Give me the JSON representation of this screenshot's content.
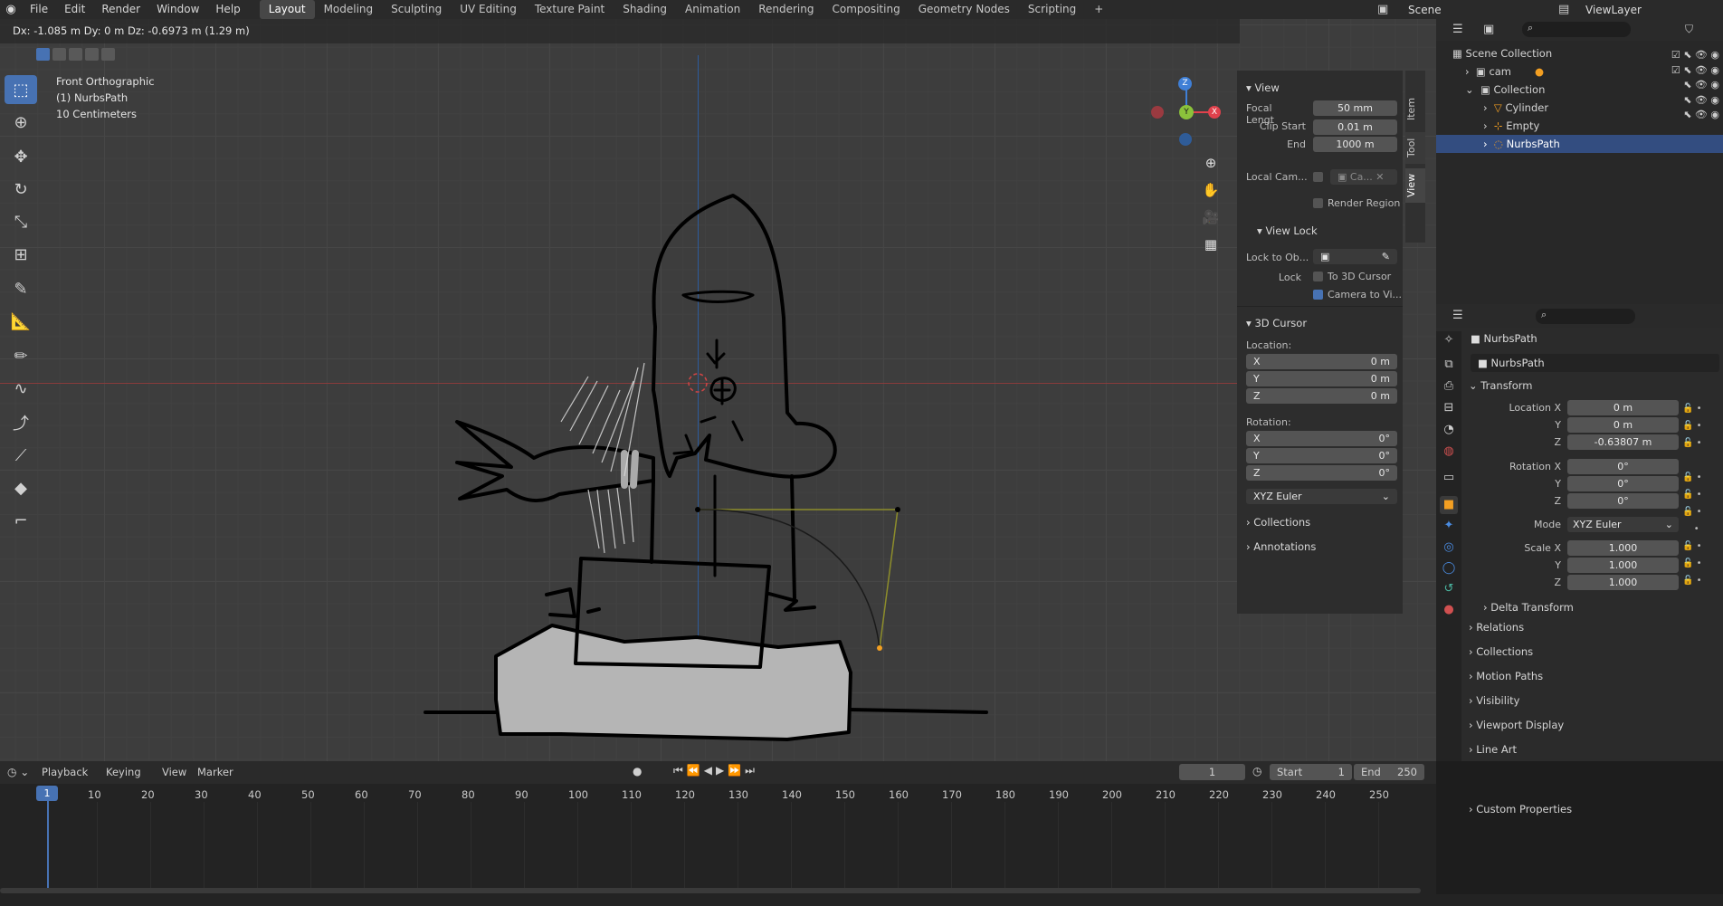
{
  "menu": {
    "blender_icon": "blender-logo-icon",
    "items": [
      "File",
      "Edit",
      "Render",
      "Window",
      "Help"
    ]
  },
  "workspaces": [
    "Layout",
    "Modeling",
    "Sculpting",
    "UV Editing",
    "Texture Paint",
    "Shading",
    "Animation",
    "Rendering",
    "Compositing",
    "Geometry Nodes",
    "Scripting"
  ],
  "scene": {
    "label": "Scene",
    "view_layer": "ViewLayer"
  },
  "viewport": {
    "header_text": "Dx: -1.085 m   Dy: 0 m   Dz: -0.6973 m (1.29 m)",
    "view_name": "Front Orthographic",
    "object_name": "(1) NurbsPath",
    "scale_text": "10 Centimeters",
    "gizmo": {
      "z": "Z",
      "y": "Y",
      "x": "X"
    }
  },
  "npanel": {
    "view_title": "View",
    "focal_label": "Focal Lengt",
    "focal_value": "50 mm",
    "clip_start_label": "Clip Start",
    "clip_start_value": "0.01 m",
    "clip_end_label": "End",
    "clip_end_value": "1000 m",
    "local_cam_label": "Local Cam...",
    "local_cam_value": "Ca...",
    "render_region": "Render Region",
    "view_lock_title": "View Lock",
    "lock_obj_label": "Lock to Ob...",
    "lock_label": "Lock",
    "to_cursor": "To 3D Cursor",
    "cam_to_view": "Camera to Vi...",
    "cursor_title": "3D Cursor",
    "location_label": "Location:",
    "loc": [
      {
        "axis": "X",
        "value": "0 m"
      },
      {
        "axis": "Y",
        "value": "0 m"
      },
      {
        "axis": "Z",
        "value": "0 m"
      }
    ],
    "rotation_label": "Rotation:",
    "rot": [
      {
        "axis": "X",
        "value": "0°"
      },
      {
        "axis": "Y",
        "value": "0°"
      },
      {
        "axis": "Z",
        "value": "0°"
      }
    ],
    "rot_mode": "XYZ Euler",
    "collections": "Collections",
    "annotations": "Annotations",
    "tabs": [
      "Item",
      "Tool",
      "View"
    ]
  },
  "outliner": {
    "root": "Scene Collection",
    "rows": [
      {
        "name": "cam",
        "indent": 1
      },
      {
        "name": "Collection",
        "indent": 1
      },
      {
        "name": "Cylinder",
        "indent": 2
      },
      {
        "name": "Empty",
        "indent": 2
      },
      {
        "name": "NurbsPath",
        "indent": 2
      }
    ]
  },
  "properties": {
    "object_name": "NurbsPath",
    "data_name": "NurbsPath",
    "transform_title": "Transform",
    "location": [
      {
        "label": "Location X",
        "value": "0 m"
      },
      {
        "label": "Y",
        "value": "0 m"
      },
      {
        "label": "Z",
        "value": "-0.63807 m"
      }
    ],
    "rotation": [
      {
        "label": "Rotation X",
        "value": "0°"
      },
      {
        "label": "Y",
        "value": "0°"
      },
      {
        "label": "Z",
        "value": "0°"
      }
    ],
    "mode_label": "Mode",
    "mode_value": "XYZ Euler",
    "scale": [
      {
        "label": "Scale X",
        "value": "1.000"
      },
      {
        "label": "Y",
        "value": "1.000"
      },
      {
        "label": "Z",
        "value": "1.000"
      }
    ],
    "delta": "Delta Transform",
    "sections": [
      "Relations",
      "Collections",
      "Motion Paths",
      "Visibility",
      "Viewport Display",
      "Line Art",
      "Custom Properties"
    ]
  },
  "timeline": {
    "menus": [
      "Playback",
      "Keying",
      "View",
      "Marker"
    ],
    "current_frame": "1",
    "start_label": "Start",
    "start_value": "1",
    "end_label": "End",
    "end_value": "250",
    "ticks": [
      "1",
      "10",
      "20",
      "30",
      "40",
      "50",
      "60",
      "70",
      "80",
      "90",
      "100",
      "110",
      "120",
      "130",
      "140",
      "150",
      "160",
      "170",
      "180",
      "190",
      "200",
      "210",
      "220",
      "230",
      "240",
      "250"
    ]
  },
  "colors": {
    "accent": "#4772b3",
    "selection": "#334d80",
    "x_axis": "#e0414c",
    "y_axis": "#8bc23b",
    "z_axis": "#3f7fd6",
    "origin": "#f39f22"
  }
}
